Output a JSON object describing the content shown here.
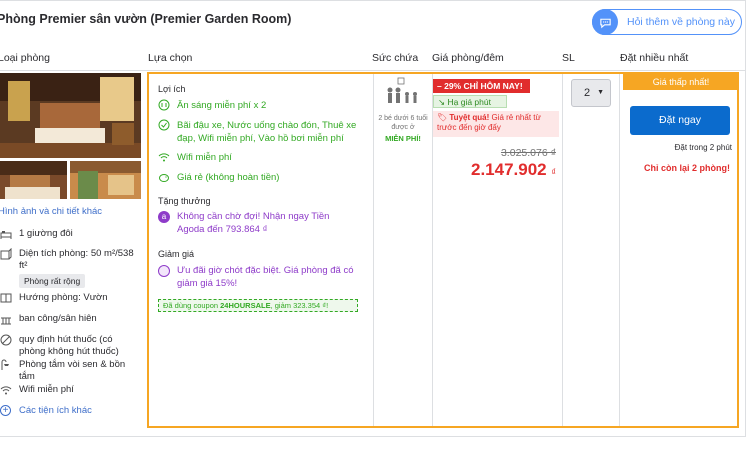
{
  "room": {
    "title": "Phòng Premier sân vườn (Premier Garden Room)"
  },
  "ask_button": {
    "label": "Hỏi thêm về phòng này",
    "icon": "chat-bubble-icon"
  },
  "columns": [
    "Loại phòng",
    "Lựa chọn",
    "Sức chứa",
    "Giá phòng/đêm",
    "SL",
    "Đặt nhiều nhất"
  ],
  "room_info": {
    "detail_link": "Hình ảnh và chi tiết khác",
    "features": [
      {
        "icon": "bed-icon",
        "text": "1 giường đôi"
      },
      {
        "icon": "area-icon",
        "text": "Diện tích phòng: 50 m²/538 ft²"
      },
      {
        "icon": "view-icon",
        "text": "Hướng phòng: Vườn"
      },
      {
        "icon": "balcony-icon",
        "text": "ban công/sân hiên"
      },
      {
        "icon": "smoking-icon",
        "text": "quy định hút thuốc (có phòng không hút thuốc)"
      },
      {
        "icon": "shower-icon",
        "text": "Phòng tắm vòi sen & bồn tắm"
      },
      {
        "icon": "wifi-icon",
        "text": "Wifi miễn phí"
      }
    ],
    "spacious_badge": "Phòng rất rộng",
    "amenities_link": "Các tiện ích khác"
  },
  "options": {
    "benefits_heading": "Lợi ích",
    "benefits": [
      {
        "icon": "breakfast-icon",
        "text": "Ăn sáng miễn phí x 2"
      },
      {
        "icon": "check-circle-icon",
        "text": "Bãi đậu xe, Nước uống chào đón, Thuê xe đạp, Wifi miễn phí, Vào hồ bơi miễn phí"
      },
      {
        "icon": "wifi-icon",
        "text": "Wifi miễn phí"
      },
      {
        "icon": "piggy-bank-icon",
        "text": "Giá rẻ (không hoàn tiền)"
      }
    ],
    "reward_heading": "Tặng thưởng",
    "reward_text": "Không cần chờ đợi! Nhận ngay Tiền Agoda đến 793.864 ₫",
    "discount_heading": "Giảm giá",
    "discount_text": "Ưu đãi giờ chót đặc biệt. Giá phòng đã có giảm giá 15%!",
    "coupon_prefix": "Đã dùng coupon ",
    "coupon_code": "24HOURSALE",
    "coupon_suffix": ", giảm 323.354 ₫!"
  },
  "capacity": {
    "adults": 2,
    "note": "2 bé dưới 6 tuổi được ở",
    "free": "MIỄN PHÍ!"
  },
  "price": {
    "deal_badge": "– 29% CHỈ HÔM NAY!",
    "last_minute": "Hạ giá phút chót!",
    "great_deal_bold": "Tuyệt quá!",
    "great_deal_text": " Giá rẻ nhất từ trước đến giờ đấy",
    "original": "3.025.076 ₫",
    "current": "2.147.902",
    "currency": "₫"
  },
  "quantity": {
    "selected": "2"
  },
  "booking": {
    "best_banner": "Giá thấp nhất!",
    "book_button": "Đặt ngay",
    "book_time": "Đặt trong 2 phút",
    "rooms_left": "Chỉ còn lại 2 phòng!"
  },
  "colors": {
    "accent": "#5392f9",
    "orange": "#f6a623",
    "green": "#32a923",
    "red": "#e12d2d",
    "book": "#0b6bcd",
    "purple": "#8e3bc9"
  }
}
